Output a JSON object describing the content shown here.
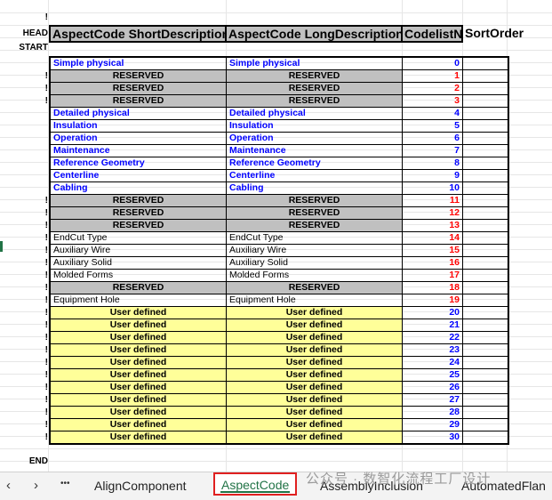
{
  "sheet": {
    "row_marks": [
      "!",
      "HEAD",
      "START",
      "END"
    ],
    "header": {
      "short": "AspectCode ShortDescription",
      "long": "AspectCode LongDescription",
      "codelist": "CodelistNumber",
      "sort": "SortOrder"
    },
    "rows": [
      {
        "type": "blue",
        "short": "Simple physical",
        "long": "Simple physical",
        "code": "0"
      },
      {
        "type": "res",
        "short": "RESERVED",
        "long": "RESERVED",
        "code": "1"
      },
      {
        "type": "res",
        "short": "RESERVED",
        "long": "RESERVED",
        "code": "2"
      },
      {
        "type": "res",
        "short": "RESERVED",
        "long": "RESERVED",
        "code": "3"
      },
      {
        "type": "blue",
        "short": "Detailed physical",
        "long": "Detailed physical",
        "code": "4"
      },
      {
        "type": "blue",
        "short": "Insulation",
        "long": "Insulation",
        "code": "5"
      },
      {
        "type": "blue",
        "short": "Operation",
        "long": "Operation",
        "code": "6"
      },
      {
        "type": "blue",
        "short": "Maintenance",
        "long": "Maintenance",
        "code": "7"
      },
      {
        "type": "blue",
        "short": "Reference Geometry",
        "long": "Reference Geometry",
        "code": "8"
      },
      {
        "type": "blue",
        "short": "Centerline",
        "long": "Centerline",
        "code": "9"
      },
      {
        "type": "blue",
        "short": "Cabling",
        "long": "Cabling",
        "code": "10"
      },
      {
        "type": "res",
        "short": "RESERVED",
        "long": "RESERVED",
        "code": "11"
      },
      {
        "type": "res",
        "short": "RESERVED",
        "long": "RESERVED",
        "code": "12"
      },
      {
        "type": "res",
        "short": "RESERVED",
        "long": "RESERVED",
        "code": "13"
      },
      {
        "type": "plain",
        "short": "EndCut Type",
        "long": "EndCut Type",
        "code": "14"
      },
      {
        "type": "plain",
        "short": "Auxiliary Wire",
        "long": "Auxiliary Wire",
        "code": "15"
      },
      {
        "type": "plain",
        "short": "Auxiliary Solid",
        "long": "Auxiliary Solid",
        "code": "16"
      },
      {
        "type": "plain",
        "short": "Molded Forms",
        "long": "Molded Forms",
        "code": "17"
      },
      {
        "type": "res",
        "short": "RESERVED",
        "long": "RESERVED",
        "code": "18"
      },
      {
        "type": "plain",
        "short": "Equipment Hole",
        "long": "Equipment Hole",
        "code": "19"
      },
      {
        "type": "user",
        "short": "User defined",
        "long": "User defined",
        "code": "20"
      },
      {
        "type": "user",
        "short": "User defined",
        "long": "User defined",
        "code": "21"
      },
      {
        "type": "user",
        "short": "User defined",
        "long": "User defined",
        "code": "22"
      },
      {
        "type": "user",
        "short": "User defined",
        "long": "User defined",
        "code": "23"
      },
      {
        "type": "user",
        "short": "User defined",
        "long": "User defined",
        "code": "24"
      },
      {
        "type": "user",
        "short": "User defined",
        "long": "User defined",
        "code": "25"
      },
      {
        "type": "user",
        "short": "User defined",
        "long": "User defined",
        "code": "26"
      },
      {
        "type": "user",
        "short": "User defined",
        "long": "User defined",
        "code": "27"
      },
      {
        "type": "user",
        "short": "User defined",
        "long": "User defined",
        "code": "28"
      },
      {
        "type": "user",
        "short": "User defined",
        "long": "User defined",
        "code": "29"
      },
      {
        "type": "user",
        "short": "User defined",
        "long": "User defined",
        "code": "30"
      }
    ]
  },
  "tabs": {
    "prev_icon": "‹",
    "next_icon": "›",
    "more_icon": "•••",
    "items": [
      "AlignComponent",
      "AspectCode",
      "AssemblyInclusion",
      "AutomatedFlan"
    ],
    "active": "AspectCode"
  },
  "watermark": "公众号 · 数智化流程工厂设计",
  "colors": {
    "blue_text": "#0000ff",
    "red_text": "#ff0000",
    "reserved_fill": "#c0c0c0",
    "user_fill": "#ffff99",
    "active_tab": "#217346",
    "highlight_border": "#e02020"
  }
}
